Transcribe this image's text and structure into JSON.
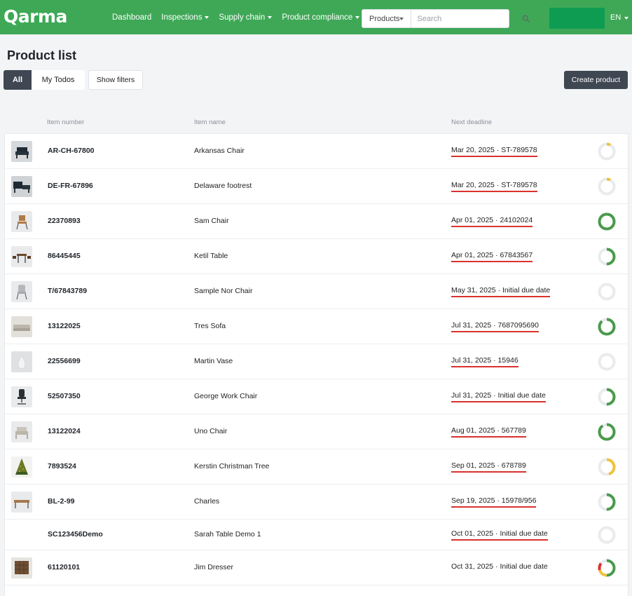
{
  "brand": {
    "logo": "Qarma"
  },
  "nav": [
    {
      "label": "Dashboard",
      "dropdown": false
    },
    {
      "label": "Inspections",
      "dropdown": true
    },
    {
      "label": "Supply chain",
      "dropdown": true
    },
    {
      "label": "Product compliance",
      "dropdown": true
    }
  ],
  "search": {
    "scope": "Products",
    "placeholder": "Search",
    "value": ""
  },
  "lang": "EN",
  "page": {
    "title": "Product list"
  },
  "tabs": {
    "all": "All",
    "todos": "My Todos"
  },
  "buttons": {
    "show_filters": "Show filters",
    "create": "Create product"
  },
  "columns": {
    "item_number": "Item number",
    "item_name": "Item name",
    "next_deadline": "Next deadline"
  },
  "colors": {
    "brand_green": "#3ea856",
    "account_green": "#0e9c53",
    "dark": "#3f4753",
    "progress_green": "#4a9a4c",
    "progress_yellow": "#f0c23a",
    "progress_red": "#d9322e",
    "progress_track": "#e9ebed"
  },
  "rows": [
    {
      "item_no": "AR-CH-67800",
      "name": "Arkansas Chair",
      "deadline": "Mar 20, 2025 · ST-789578",
      "overdue": true,
      "thumb": "dark-chair",
      "progress": [
        {
          "c": "progress_yellow",
          "v": 0.08
        }
      ]
    },
    {
      "item_no": "DE-FR-67896",
      "name": "Delaware footrest",
      "deadline": "Mar 20, 2025 · ST-789578",
      "overdue": true,
      "thumb": "dark-footrest",
      "progress": [
        {
          "c": "progress_yellow",
          "v": 0.08
        }
      ]
    },
    {
      "item_no": "22370893",
      "name": "Sam Chair",
      "deadline": "Apr 01, 2025 · 24102024",
      "overdue": true,
      "thumb": "wood-chair",
      "progress": [
        {
          "c": "progress_green",
          "v": 1.0
        }
      ]
    },
    {
      "item_no": "86445445",
      "name": "Ketil Table",
      "deadline": "Apr 01, 2025 · 67843567",
      "overdue": true,
      "thumb": "table-set",
      "progress": [
        {
          "c": "progress_green",
          "v": 0.5
        }
      ]
    },
    {
      "item_no": "T/67843789",
      "name": "Sample Nor Chair",
      "deadline": "May 31, 2025 · Initial due date",
      "overdue": true,
      "thumb": "grey-chair",
      "progress": []
    },
    {
      "item_no": "13122025",
      "name": "Tres Sofa",
      "deadline": "Jul 31, 2025 · 7687095690",
      "overdue": true,
      "thumb": "sofa",
      "progress": [
        {
          "c": "progress_green",
          "v": 0.88
        }
      ]
    },
    {
      "item_no": "22556699",
      "name": "Martin Vase",
      "deadline": "Jul 31, 2025 · 15946",
      "overdue": true,
      "thumb": "vase",
      "progress": []
    },
    {
      "item_no": "52507350",
      "name": "George Work Chair",
      "deadline": "Jul 31, 2025 · Initial due date",
      "overdue": true,
      "thumb": "office-chair",
      "progress": [
        {
          "c": "progress_green",
          "v": 0.5
        }
      ]
    },
    {
      "item_no": "13122024",
      "name": "Uno Chair",
      "deadline": "Aug 01, 2025 · 567789",
      "overdue": true,
      "thumb": "armchair",
      "progress": [
        {
          "c": "progress_green",
          "v": 0.9
        }
      ]
    },
    {
      "item_no": "7893524",
      "name": "Kerstin Christman Tree",
      "deadline": "Sep 01, 2025 · 678789",
      "overdue": true,
      "thumb": "tree",
      "progress": [
        {
          "c": "progress_yellow",
          "v": 0.45
        }
      ]
    },
    {
      "item_no": "BL-2-99",
      "name": "Charles",
      "deadline": "Sep 19, 2025 · 15978/956",
      "overdue": true,
      "thumb": "bench",
      "progress": [
        {
          "c": "progress_green",
          "v": 0.5
        }
      ]
    },
    {
      "item_no": "SC123456Demo",
      "name": "Sarah Table Demo 1",
      "deadline": "Oct 01, 2025 · Initial due date",
      "overdue": true,
      "thumb": "",
      "progress": []
    },
    {
      "item_no": "61120101",
      "name": "Jim Dresser",
      "deadline": "Oct 31, 2025 · Initial due date",
      "overdue": false,
      "thumb": "dresser",
      "progress": [
        {
          "c": "progress_green",
          "v": 0.5
        },
        {
          "c": "progress_yellow",
          "v": 0.2
        },
        {
          "c": "progress_red",
          "v": 0.15
        }
      ]
    }
  ]
}
